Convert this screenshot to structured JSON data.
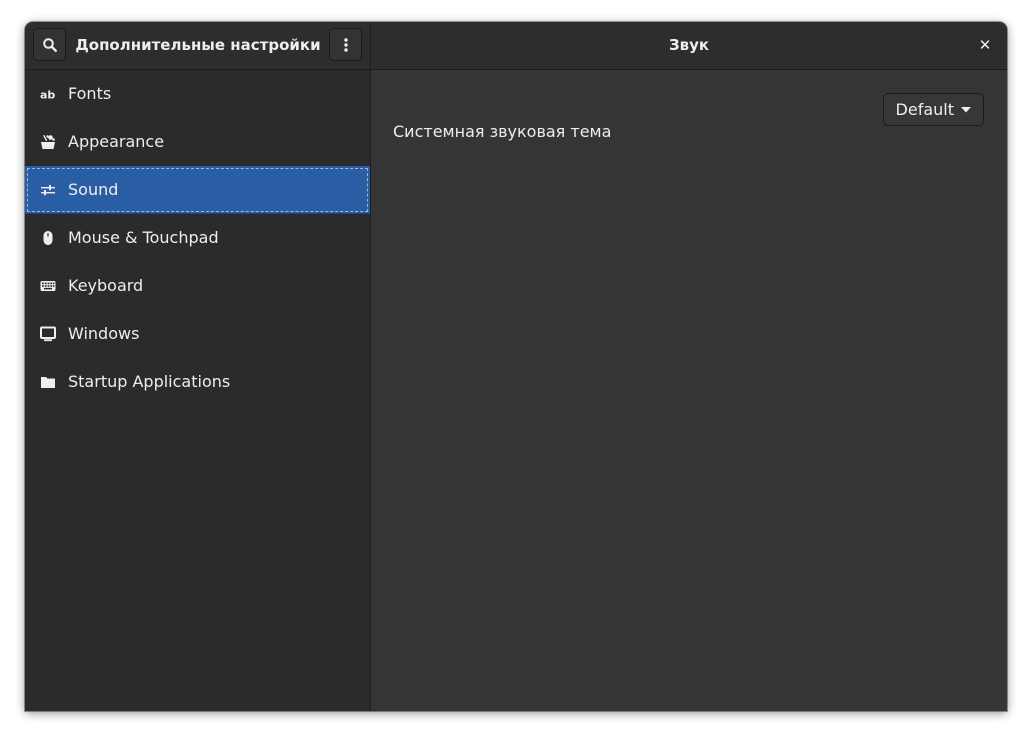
{
  "window": {
    "sidebar_title": "Дополнительные настройки",
    "panel_title": "Звук",
    "close_glyph": "✕"
  },
  "sidebar": {
    "items": [
      {
        "label": "Fonts",
        "icon": "fonts-icon"
      },
      {
        "label": "Appearance",
        "icon": "appearance-icon"
      },
      {
        "label": "Sound",
        "icon": "sound-sliders-icon",
        "selected": true
      },
      {
        "label": "Mouse & Touchpad",
        "icon": "mouse-icon"
      },
      {
        "label": "Keyboard",
        "icon": "keyboard-icon"
      },
      {
        "label": "Windows",
        "icon": "monitor-icon"
      },
      {
        "label": "Startup Applications",
        "icon": "folder-icon"
      }
    ]
  },
  "sound": {
    "theme_label": "Системная звуковая тема",
    "theme_value": "Default"
  },
  "colors": {
    "accent": "#2a5ea4",
    "window_bg": "#353535",
    "sidebar_bg": "#2b2b2b",
    "text": "#eeeeec"
  }
}
